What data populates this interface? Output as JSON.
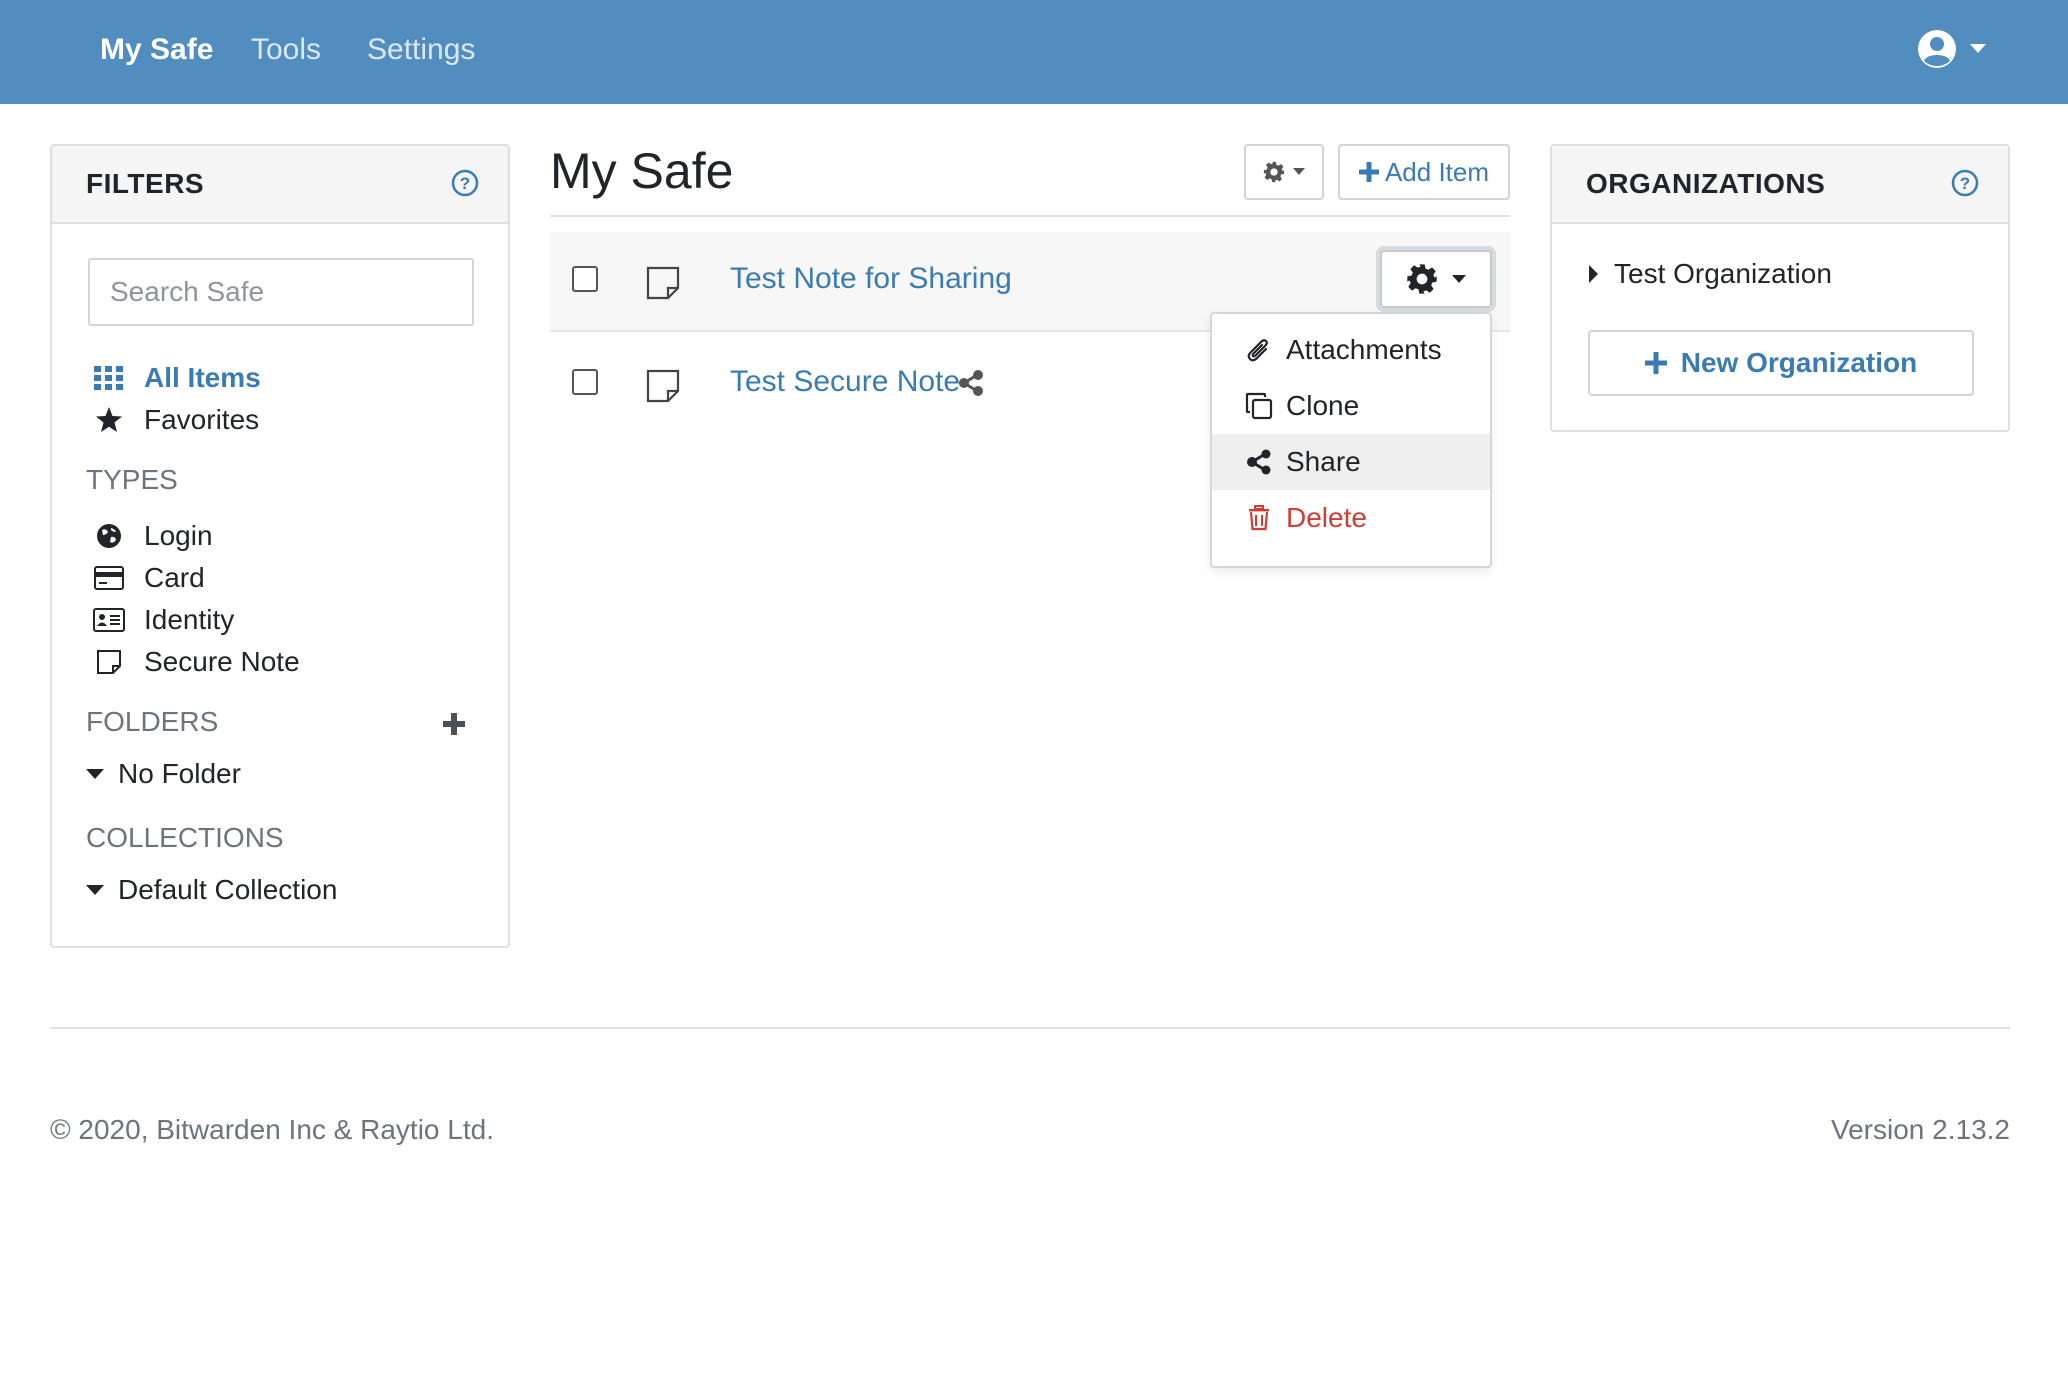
{
  "nav": {
    "items": [
      {
        "label": "My Safe"
      },
      {
        "label": "Tools"
      },
      {
        "label": "Settings"
      }
    ]
  },
  "filters": {
    "title": "FILTERS",
    "search_placeholder": "Search Safe",
    "all_items": "All Items",
    "favorites": "Favorites",
    "types_label": "TYPES",
    "types": [
      {
        "label": "Login",
        "icon": "globe-icon"
      },
      {
        "label": "Card",
        "icon": "credit-card-icon"
      },
      {
        "label": "Identity",
        "icon": "id-card-icon"
      },
      {
        "label": "Secure Note",
        "icon": "sticky-note-icon"
      }
    ],
    "folders_label": "FOLDERS",
    "folders": [
      {
        "label": "No Folder"
      }
    ],
    "collections_label": "COLLECTIONS",
    "collections": [
      {
        "label": "Default Collection"
      }
    ]
  },
  "main": {
    "title": "My Safe",
    "add_item_label": "Add Item",
    "items": [
      {
        "name": "Test Note for Sharing",
        "shared": false
      },
      {
        "name": "Test Secure Note",
        "shared": true
      }
    ],
    "item_menu": [
      {
        "label": "Attachments",
        "icon": "paperclip-icon"
      },
      {
        "label": "Clone",
        "icon": "clone-icon"
      },
      {
        "label": "Share",
        "icon": "share-icon"
      },
      {
        "label": "Delete",
        "icon": "trash-icon"
      }
    ]
  },
  "organizations": {
    "title": "ORGANIZATIONS",
    "items": [
      {
        "label": "Test Organization"
      }
    ],
    "new_label": "New Organization"
  },
  "footer": {
    "copyright": "© 2020, Bitwarden Inc & Raytio Ltd.",
    "version": "Version 2.13.2"
  },
  "colors": {
    "nav_bg": "#518dbe",
    "link": "#3b7bb3",
    "danger": "#cf3e35"
  }
}
